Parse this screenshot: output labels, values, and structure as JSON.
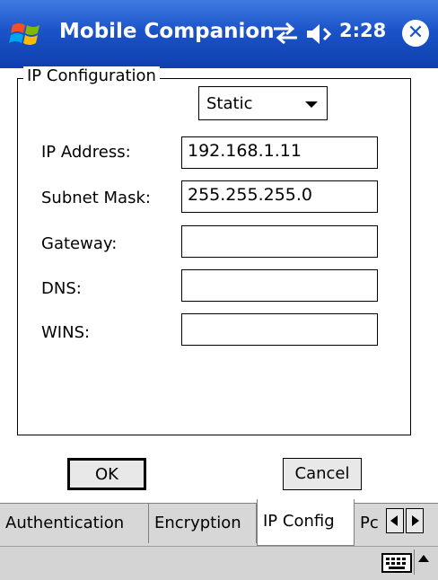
{
  "title_bar": {
    "app_title": "Mobile Companion",
    "clock": "2:28",
    "close_glyph": "✕",
    "icons": [
      "windows-start-icon",
      "connectivity-icon",
      "speaker-icon",
      "close-icon"
    ]
  },
  "ip_config": {
    "group_label": "IP Configuration",
    "mode_value": "Static",
    "fields": [
      {
        "label": "IP Address:",
        "value": "192.168.1.11"
      },
      {
        "label": "Subnet Mask:",
        "value": "255.255.255.0"
      },
      {
        "label": "Gateway:",
        "value": ""
      },
      {
        "label": "DNS:",
        "value": ""
      },
      {
        "label": "WINS:",
        "value": ""
      }
    ]
  },
  "buttons": {
    "ok_label": "OK",
    "cancel_label": "Cancel"
  },
  "tabs": [
    {
      "label": "Authentication",
      "active": false
    },
    {
      "label": "Encryption",
      "active": false
    },
    {
      "label": "IP Config",
      "active": true
    },
    {
      "label": "Pc",
      "active": false
    }
  ],
  "colors": {
    "title_bar": "#1b53c8",
    "tab_background": "#d7d7d7",
    "window_background": "#ffffff"
  }
}
